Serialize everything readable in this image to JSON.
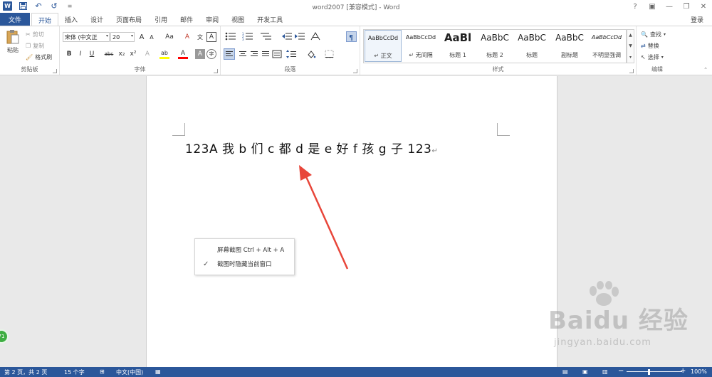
{
  "window": {
    "title": "word2007 [兼容模式] - Word",
    "help": "?",
    "controls": [
      "▣",
      "—",
      "❐",
      "✕"
    ]
  },
  "qat": {
    "undo": "↶",
    "redo": "↺",
    "more": "≡"
  },
  "tabs": {
    "file": "文件",
    "items": [
      "开始",
      "插入",
      "设计",
      "页面布局",
      "引用",
      "邮件",
      "审阅",
      "视图",
      "开发工具"
    ],
    "login": "登录"
  },
  "ribbon": {
    "clipboard": {
      "label": "剪贴板",
      "paste": "粘贴",
      "cut": "剪切",
      "copy": "复制",
      "format_painter": "格式刷"
    },
    "font": {
      "label": "字体",
      "font_name": "宋体 (中文正",
      "font_size": "20",
      "grow": "A",
      "shrink": "A",
      "change_case": "Aa",
      "clear_format": "A",
      "phonetic": "文",
      "border": "A",
      "bold": "B",
      "italic": "I",
      "underline": "U",
      "strike": "abc",
      "subscript": "x₂",
      "superscript": "x²",
      "text_effect": "A",
      "highlight": "ab",
      "font_color": "A",
      "shading": "A",
      "enclose": "字"
    },
    "paragraph": {
      "label": "段落"
    },
    "styles": {
      "label": "样式",
      "items": [
        {
          "sample": "AaBbCcDd",
          "name": "↵ 正文"
        },
        {
          "sample": "AaBbCcDd",
          "name": "↵ 无间隔"
        },
        {
          "sample": "AaBl",
          "name": "标题 1"
        },
        {
          "sample": "AaBbC",
          "name": "标题 2"
        },
        {
          "sample": "AaBbC",
          "name": "标题"
        },
        {
          "sample": "AaBbC",
          "name": "副标题"
        },
        {
          "sample": "AaBbCcDd",
          "name": "不明显强调"
        }
      ]
    },
    "editing": {
      "label": "编辑",
      "find": "查找",
      "replace": "替换",
      "select": "选择"
    }
  },
  "document": {
    "text": "123A 我 b 们 c 都 d 是 e 好 f 孩 g 子 123",
    "para_mark": "↵"
  },
  "context_menu": {
    "items": [
      {
        "label": "屏幕截图 Ctrl + Alt + A",
        "checked": false
      },
      {
        "label": "截图时隐藏当前窗口",
        "checked": true
      }
    ]
  },
  "badge": "71",
  "watermark": {
    "main": "Baidu 经验",
    "sub": "jingyan.baidu.com"
  },
  "statusbar": {
    "page": "第 2 页，共 2 页",
    "words": "15 个字",
    "language": "中文(中国)",
    "zoom_minus": "−",
    "zoom_plus": "+",
    "zoom": "100%"
  },
  "colors": {
    "accent": "#2b579a",
    "highlight": "#ffff00",
    "font_color": "#ff0000"
  }
}
